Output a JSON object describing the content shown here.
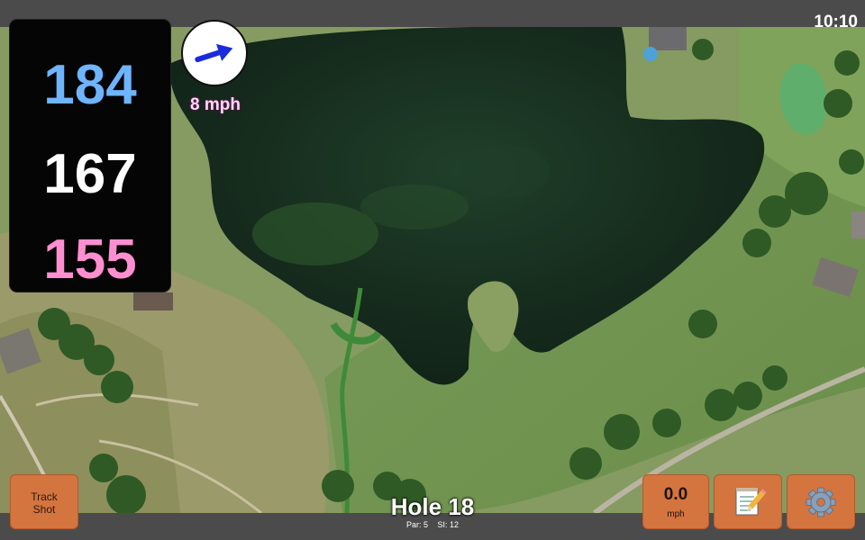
{
  "status": {
    "time": "10:10"
  },
  "distances": {
    "back": "184",
    "middle": "167",
    "front": "155"
  },
  "wind": {
    "label": "8 mph",
    "direction_icon": "arrow-east-northeast"
  },
  "buttons": {
    "track_shot_line1": "Track",
    "track_shot_line2": "Shot",
    "speed_value": "0.0",
    "speed_unit": "mph",
    "notes_icon": "notepad-icon",
    "settings_icon": "gear-icon"
  },
  "hole": {
    "title": "Hole 18",
    "par": "Par: 5",
    "si": "SI: 12"
  },
  "colors": {
    "back": "#6fb4ff",
    "middle": "#ffffff",
    "front": "#ff8fd0",
    "button": "#d4743f",
    "wind_label": "#ffd8f6"
  }
}
